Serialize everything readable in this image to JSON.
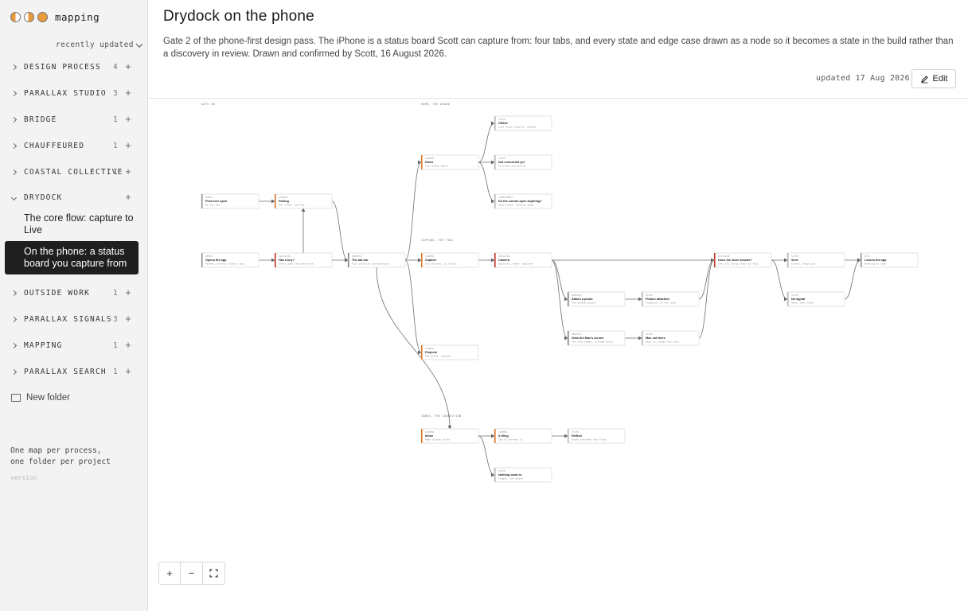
{
  "app": {
    "name": "mapping",
    "logo_colors": [
      "#e89a3c",
      "#e89a3c",
      "#e89a3c"
    ]
  },
  "sidebar": {
    "sort_label": "recently updated",
    "folders": [
      {
        "name": "DESIGN PROCESS",
        "count": "4"
      },
      {
        "name": "PARALLAX STUDIO",
        "count": "3"
      },
      {
        "name": "BRIDGE",
        "count": "1"
      },
      {
        "name": "CHAUFFEURED",
        "count": "1"
      },
      {
        "name": "COASTAL COLLECTIVE",
        "count": "1"
      },
      {
        "name": "DRYDOCK",
        "count": ""
      },
      {
        "name": "OUTSIDE WORK",
        "count": "1"
      },
      {
        "name": "PARALLAX SIGNALS",
        "count": "3"
      },
      {
        "name": "MAPPING",
        "count": "1"
      },
      {
        "name": "PARALLAX SEARCH",
        "count": "1"
      }
    ],
    "drydock_docs": [
      {
        "title": "The core flow: capture to Live"
      },
      {
        "title": "On the phone: a status board you capture from"
      }
    ],
    "new_folder_label": "New folder",
    "footer": [
      "One map per process,",
      "one folder per project"
    ],
    "version_label": "version"
  },
  "page": {
    "title": "Drydock on the phone",
    "description": "Gate 2 of the phone-first design pass. The iPhone is a status board Scott can capture from: four tabs, and every state and edge case drawn as a node so it becomes a state in the build rather than a discovery in review. Drawn and confirmed by Scott, 16 August 2026.",
    "updated": "updated 17 Aug 2026",
    "edit_label": "Edit"
  },
  "map": {
    "accent_colors": {
      "entry": "#999999",
      "screen": "#e07a2e",
      "decision": "#c0392b",
      "state": "#bbbbbb",
      "process": "#888888"
    },
    "lanes": [
      {
        "label": "DAYS IN"
      },
      {
        "label": "HOME, THE BOARD"
      },
      {
        "label": "CAPTURE, THE TOOL"
      },
      {
        "label": "INBOX, THE CONNECTION"
      }
    ],
    "nodes": [
      {
        "id": "first",
        "kind": "ENTRY",
        "title": "First ever open",
        "sub": "No key yet"
      },
      {
        "id": "pairing",
        "kind": "SCREEN",
        "title": "Pairing",
        "sub": "One field, one key"
      },
      {
        "id": "opens",
        "kind": "ENTRY",
        "title": "Opens the app",
        "sub": "Pocket, several times a day"
      },
      {
        "id": "haskey",
        "kind": "DECISION",
        "title": "Has a key?",
        "sub": "Every open launches here"
      },
      {
        "id": "tabbar",
        "kind": "PROCESS",
        "title": "The tab bar",
        "sub": "Four parallel destinations"
      },
      {
        "id": "home",
        "kind": "SCREEN",
        "title": "Home",
        "sub": "The status board"
      },
      {
        "id": "offline",
        "kind": "STATE",
        "title": "Offline",
        "sub": "Last known figures, marked"
      },
      {
        "id": "notconn",
        "kind": "STATE",
        "title": "Not connected yet",
        "sub": "Finished and spline"
      },
      {
        "id": "counts",
        "kind": "COMMITMENT",
        "title": "Do the counts open anything?",
        "sub": "Unverified, nothing shown"
      },
      {
        "id": "capture",
        "kind": "SCREEN",
        "title": "Capture",
        "sub": "Two seconds, no fields"
      },
      {
        "id": "camera",
        "kind": "DECISION",
        "title": "Camera",
        "sub": "Optional, never required"
      },
      {
        "id": "attach",
        "kind": "PROCESS",
        "title": "Attach a photo",
        "sub": "The system picker"
      },
      {
        "id": "picture",
        "kind": "STATE",
        "title": "Picture attached",
        "sub": "Thumbnail on the note"
      },
      {
        "id": "grab",
        "kind": "PROCESS",
        "title": "Grab the Mac's screen",
        "sub": "The what keeps, already built"
      },
      {
        "id": "macnot",
        "kind": "STATE",
        "title": "Mac not there",
        "sub": "Says so, keeps the note"
      },
      {
        "id": "store",
        "kind": "DECISION",
        "title": "Does the store answer?",
        "sub": "The only thing that can fail"
      },
      {
        "id": "sent",
        "kind": "STATE",
        "title": "Sent",
        "sub": "Clears, stays put"
      },
      {
        "id": "nosignal",
        "kind": "STATE",
        "title": "No signal",
        "sub": "Held, sent later"
      },
      {
        "id": "leaves",
        "kind": "EXIT",
        "title": "Leaves the app",
        "sub": "Nothing to lose"
      },
      {
        "id": "projects",
        "kind": "SCREEN",
        "title": "Projects",
        "sub": "The board, stacked"
      },
      {
        "id": "inbox",
        "kind": "SCREEN",
        "title": "Inbox",
        "sub": "What Claude filed"
      },
      {
        "id": "filing",
        "kind": "SCREEN",
        "title": "A filing",
        "sub": "Tap to correct it"
      },
      {
        "id": "refiled",
        "kind": "STATE",
        "title": "Refiled",
        "sub": "Draft outranks the files"
      },
      {
        "id": "nothing",
        "kind": "STATE",
        "title": "Nothing came in",
        "sub": "Taught, not blank"
      }
    ]
  },
  "zoom": {
    "in": "+",
    "out": "−"
  }
}
